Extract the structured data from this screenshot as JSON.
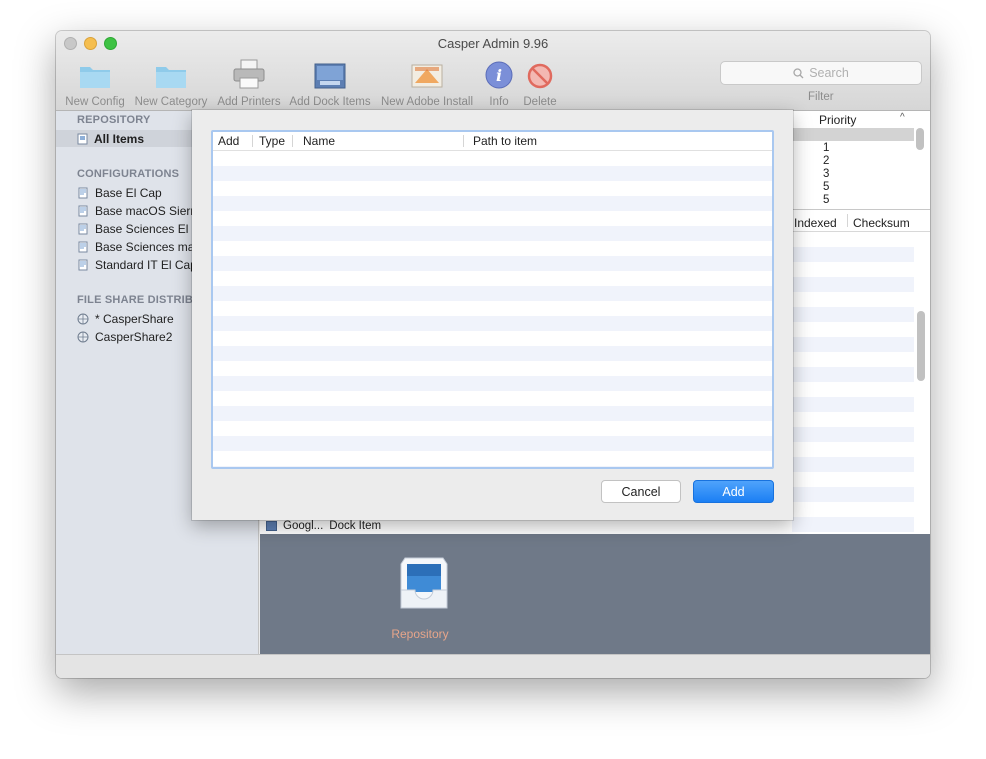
{
  "window": {
    "title": "Casper Admin 9.96"
  },
  "toolbar": {
    "items": [
      {
        "label": "New Config",
        "icon": "folder-icon"
      },
      {
        "label": "New Category",
        "icon": "folder-icon"
      },
      {
        "label": "Add Printers",
        "icon": "printer-icon"
      },
      {
        "label": "Add Dock Items",
        "icon": "dock-icon"
      },
      {
        "label": "New Adobe Install",
        "icon": "adobe-installer-icon"
      },
      {
        "label": "Info",
        "icon": "info-icon"
      },
      {
        "label": "Delete",
        "icon": "delete-icon"
      }
    ],
    "search_placeholder": "Search",
    "filter_label": "Filter"
  },
  "sidebar": {
    "repository_heading": "REPOSITORY",
    "repository_items": [
      {
        "label": "All Items",
        "selected": true
      }
    ],
    "configurations_heading": "CONFIGURATIONS",
    "configurations": [
      "Base El Cap",
      "Base macOS Sierra",
      "Base Sciences El C",
      "Base Sciences mac",
      "Standard IT El Cap"
    ],
    "file_share_heading": "FILE SHARE DISTRIB",
    "file_shares": [
      "* CasperShare",
      "CasperShare2"
    ]
  },
  "background_table": {
    "priority_header": "Priority",
    "priority_values": [
      "1",
      "2",
      "3",
      "5",
      "5"
    ],
    "indexed_header": "Indexed",
    "checksum_header": "Checksum",
    "bottom_row": {
      "name": "Googl...",
      "type": "Dock Item"
    }
  },
  "repository_pane": {
    "label": "Repository"
  },
  "sheet": {
    "columns": [
      "Add",
      "Type",
      "Name",
      "Path to item"
    ],
    "cancel_label": "Cancel",
    "add_label": "Add"
  },
  "colors": {
    "accent": "#1b7ff4",
    "selection": "#cfd3da",
    "sidebar": "#dfe3ea",
    "stripe": "#f0f3fb"
  }
}
